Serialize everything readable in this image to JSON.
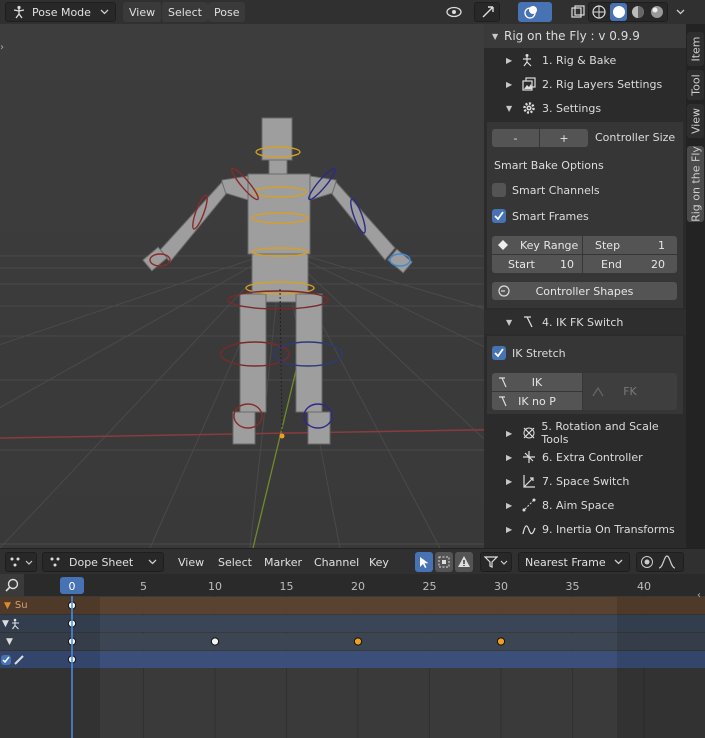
{
  "viewport_header": {
    "mode": "Pose Mode",
    "menus": [
      "View",
      "Select",
      "Pose"
    ]
  },
  "side_tabs": [
    "Item",
    "Tool",
    "View",
    "Rig on the Fly"
  ],
  "panel": {
    "title": "Rig on the Fly : v 0.9.9",
    "sections": [
      {
        "label": "1. Rig & Bake",
        "icon": "armature-icon"
      },
      {
        "label": "2. Rig Layers Settings",
        "icon": "layers-icon"
      },
      {
        "label": "3. Settings",
        "icon": "gear-icon"
      }
    ],
    "settings": {
      "minus": "-",
      "plus": "+",
      "controller_size": "Controller Size",
      "smart_bake_options": "Smart Bake Options",
      "smart_channels": "Smart Channels",
      "smart_channels_checked": false,
      "smart_frames": "Smart Frames",
      "smart_frames_checked": true,
      "key_range": "Key Range",
      "step_label": "Step",
      "step_value": "1",
      "start_label": "Start",
      "start_value": "10",
      "end_label": "End",
      "end_value": "20",
      "controller_shapes": "Controller Shapes"
    },
    "ikfk": {
      "label": "4. IK FK Switch",
      "ik_stretch": "IK Stretch",
      "ik_stretch_checked": true,
      "ik": "IK",
      "ik_no_p": "IK no P",
      "fk": "FK"
    },
    "more_sections": [
      "5. Rotation and Scale Tools",
      "6. Extra Controller",
      "7. Space Switch",
      "8. Aim Space",
      "9. Inertia On Transforms"
    ]
  },
  "dope_header": {
    "editor": "Dope Sheet",
    "menus": [
      "View",
      "Select",
      "Marker",
      "Channel",
      "Key"
    ],
    "snap": "Nearest Frame"
  },
  "timeline": {
    "current_frame": "0",
    "frame_labels": [
      "5",
      "10",
      "15",
      "20",
      "25",
      "30",
      "35",
      "40"
    ],
    "channel_labels": [
      "Su"
    ],
    "keyframes": {
      "row3_selected_frames": [
        20,
        30
      ],
      "row3_unselected_frames": [
        0,
        10
      ]
    }
  },
  "colors": {
    "accent": "#4772b3",
    "keyframe_selected": "#f0a020",
    "summary_row": "#5a4230",
    "selected_row": "#3c4f7a"
  }
}
